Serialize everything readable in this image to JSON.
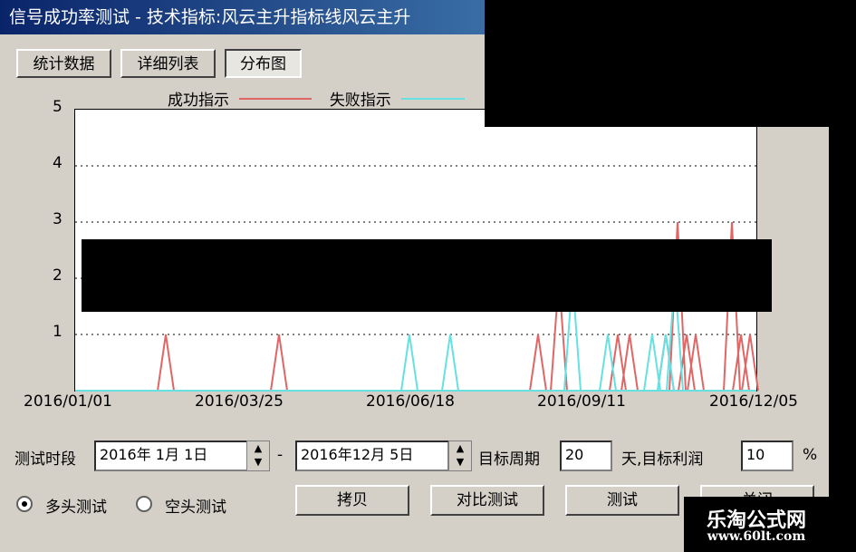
{
  "window": {
    "title": "信号成功率测试 - 技术指标:风云主升指标线风云主升"
  },
  "tabs": [
    {
      "label": "统计数据"
    },
    {
      "label": "详细列表"
    },
    {
      "label": "分布图"
    }
  ],
  "chart_data": {
    "type": "line",
    "legend_position": "top",
    "series": [
      {
        "name": "成功指示",
        "color": "#e06666"
      },
      {
        "name": "失败指示",
        "color": "#66e0e0"
      }
    ],
    "ylim": [
      0,
      5
    ],
    "y_ticks": [
      "5",
      "4",
      "3",
      "2",
      "1"
    ],
    "x_ticks": [
      "2016/01/01",
      "2016/03/25",
      "2016/06/18",
      "2016/09/11",
      "2016/12/05"
    ],
    "grid": true
  },
  "controls": {
    "period_label": "测试时段",
    "start_date": "2016年 1月 1日",
    "dash": "-",
    "end_date": "2016年12月 5日",
    "target_period_label": "目标周期",
    "target_period_value": "20",
    "target_profit_label": "天,目标利润",
    "target_profit_value": "10",
    "percent": "%",
    "radio_long": "多头测试",
    "radio_short": "空头测试"
  },
  "buttons": {
    "copy": "拷贝",
    "compare": "对比测试",
    "test": "测试",
    "close": "关闭"
  },
  "watermark": {
    "line1": "乐淘公式网",
    "line2": "www.60lt.com"
  }
}
